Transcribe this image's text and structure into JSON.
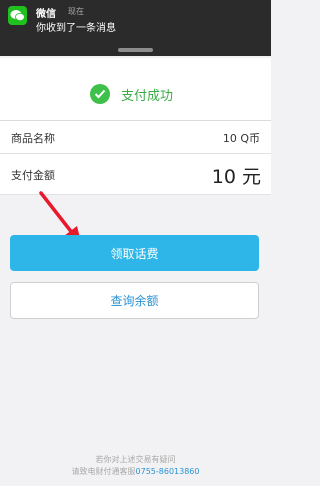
{
  "notification": {
    "app_name": "微信",
    "time": "现在",
    "message": "你收到了一条消息"
  },
  "success": {
    "text": "支付成功"
  },
  "rows": [
    {
      "label": "商品名称",
      "value": "10 Q币"
    },
    {
      "label": "支付金额",
      "value": "10 元"
    }
  ],
  "buttons": {
    "primary_label": "领取话费",
    "secondary_label": "查询余额"
  },
  "footer": {
    "line1": "若你对上述交易有疑问",
    "line2_prefix": "请致电财付通客服",
    "phone": "0755-86013860"
  },
  "colors": {
    "success_green": "#3ec04b",
    "primary_blue": "#2fb6e8",
    "link_blue": "#2a93d5",
    "arrow_red": "#e8192c"
  },
  "icons": {
    "notification_app": "wechat-icon",
    "success": "checkmark-icon",
    "annotation": "red-arrow-icon"
  }
}
